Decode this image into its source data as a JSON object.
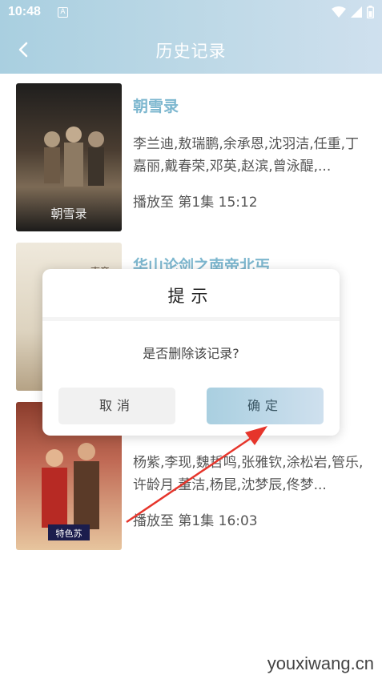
{
  "status_bar": {
    "time": "10:48",
    "a_label": "A"
  },
  "header": {
    "title": "历史记录"
  },
  "items": [
    {
      "title": "朝雪录",
      "cast": "李兰迪,敖瑞鹏,余承恩,沈羽洁,任重,丁嘉丽,戴春荣,邓英,赵滨,曾泳醍,...",
      "progress": "播放至 第1集 15:12",
      "poster_colors": [
        "#2b2a28",
        "#5b4a3a",
        "#8f7b62"
      ]
    },
    {
      "title": "华山论剑之南帝北丐",
      "cast": "",
      "progress": "",
      "poster_colors": [
        "#e8e1d3",
        "#d3c7b1",
        "#a38f73"
      ]
    },
    {
      "title": "",
      "cast": "杨紫,李现,魏哲鸣,张雅钦,涂松岩,管乐,许龄月,董洁,杨昆,沈梦辰,佟梦...",
      "progress": "播放至 第1集 16:03",
      "poster_colors": [
        "#8c2f22",
        "#c1574a",
        "#e0b08a"
      ]
    }
  ],
  "dialog": {
    "title": "提示",
    "message": "是否删除该记录?",
    "cancel_label": "取消",
    "ok_label": "确定"
  },
  "watermark": "youxiwang.cn",
  "colors": {
    "accent": "#a9cfe0",
    "title_link": "#7db7cf",
    "arrow": "#e6352b"
  }
}
